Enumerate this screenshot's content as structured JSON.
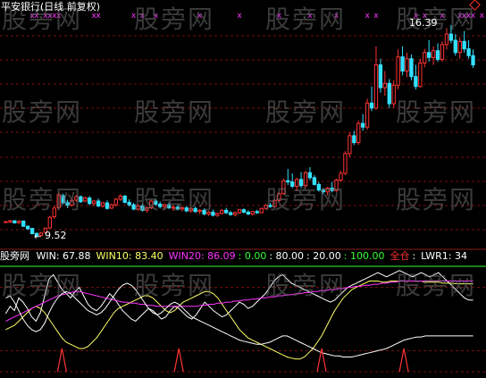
{
  "title": "平安银行(日线 前复权)",
  "watermark": "股旁网",
  "price_labels": {
    "high": "16.39",
    "low": "9.52"
  },
  "indicator_bar": {
    "name": "股旁网",
    "items": [
      {
        "text": "WIN: 67.88",
        "color": "#ffffff"
      },
      {
        "text": "WIN10: 83.40",
        "color": "#ffff66"
      },
      {
        "text": "WIN20: 86.09",
        "color": "#ff33ff"
      },
      {
        "text": ": 0.00",
        "color": "#33ff33"
      },
      {
        "text": ": 80.00",
        "color": "#ffffff"
      },
      {
        "text": ": 20.00",
        "color": "#ffffff"
      },
      {
        "text": ": 100.00",
        "color": "#33ff33"
      },
      {
        "text": "全仓",
        "color": "#ff3333"
      },
      {
        "text": ": ",
        "color": "#ffffff"
      },
      {
        "text": "LWR1: 34",
        "color": "#ffffff"
      }
    ]
  },
  "colors": {
    "background": "#000000",
    "up": "#ff3333",
    "down": "#33e0ff",
    "grid": "#7a1010",
    "win": "#ffffff",
    "win10": "#ffff66",
    "win20": "#ff33ff",
    "level100": "#33ff33",
    "signal": "#ff3333"
  },
  "chart_data": [
    {
      "type": "candlestick",
      "title": "平安银行(日线 前复权)",
      "ylim": [
        9.2,
        16.8
      ],
      "annotations": [
        {
          "text": "16.39",
          "label_of": "max"
        },
        {
          "text": "9.52",
          "label_of": "min"
        }
      ],
      "marker_symbol": "x",
      "ohlc": [
        [
          10.0,
          10.03,
          9.98,
          10.01
        ],
        [
          10.0,
          10.07,
          9.97,
          10.04
        ],
        [
          10.04,
          10.06,
          9.95,
          9.97
        ],
        [
          9.98,
          10.06,
          9.93,
          10.02
        ],
        [
          10.03,
          10.05,
          9.85,
          9.86
        ],
        [
          9.86,
          9.89,
          9.75,
          9.78
        ],
        [
          9.79,
          9.81,
          9.6,
          9.62
        ],
        [
          9.63,
          9.66,
          9.52,
          9.55
        ],
        [
          9.56,
          9.68,
          9.53,
          9.64
        ],
        [
          9.66,
          9.82,
          9.63,
          9.8
        ],
        [
          9.81,
          10.2,
          9.78,
          10.15
        ],
        [
          10.17,
          10.52,
          10.1,
          10.45
        ],
        [
          10.47,
          10.95,
          10.4,
          10.88
        ],
        [
          10.85,
          10.92,
          10.58,
          10.62
        ],
        [
          10.63,
          10.72,
          10.45,
          10.55
        ],
        [
          10.55,
          10.75,
          10.5,
          10.7
        ],
        [
          10.71,
          10.88,
          10.65,
          10.82
        ],
        [
          10.82,
          10.86,
          10.62,
          10.66
        ],
        [
          10.68,
          10.82,
          10.64,
          10.78
        ],
        [
          10.78,
          10.84,
          10.55,
          10.6
        ],
        [
          10.6,
          10.72,
          10.52,
          10.68
        ],
        [
          10.68,
          10.76,
          10.48,
          10.52
        ],
        [
          10.52,
          10.66,
          10.46,
          10.62
        ],
        [
          10.62,
          10.7,
          10.4,
          10.44
        ],
        [
          10.45,
          10.6,
          10.42,
          10.56
        ],
        [
          10.56,
          10.78,
          10.5,
          10.74
        ],
        [
          10.74,
          10.9,
          10.68,
          10.84
        ],
        [
          10.84,
          10.88,
          10.6,
          10.64
        ],
        [
          10.64,
          10.74,
          10.5,
          10.56
        ],
        [
          10.56,
          10.62,
          10.38,
          10.42
        ],
        [
          10.42,
          10.58,
          10.36,
          10.52
        ],
        [
          10.52,
          10.6,
          10.34,
          10.38
        ],
        [
          10.38,
          10.5,
          10.3,
          10.46
        ],
        [
          10.46,
          10.72,
          10.42,
          10.68
        ],
        [
          10.68,
          10.76,
          10.52,
          10.58
        ],
        [
          10.58,
          10.66,
          10.44,
          10.5
        ],
        [
          10.5,
          10.6,
          10.4,
          10.56
        ],
        [
          10.56,
          10.64,
          10.42,
          10.46
        ],
        [
          10.46,
          10.54,
          10.36,
          10.48
        ],
        [
          10.48,
          10.56,
          10.38,
          10.42
        ],
        [
          10.42,
          10.5,
          10.34,
          10.46
        ],
        [
          10.46,
          10.52,
          10.32,
          10.36
        ],
        [
          10.36,
          10.48,
          10.3,
          10.44
        ],
        [
          10.44,
          10.5,
          10.3,
          10.34
        ],
        [
          10.34,
          10.42,
          10.26,
          10.38
        ],
        [
          10.38,
          10.44,
          10.22,
          10.26
        ],
        [
          10.26,
          10.36,
          10.2,
          10.32
        ],
        [
          10.32,
          10.4,
          10.18,
          10.22
        ],
        [
          10.22,
          10.3,
          10.16,
          10.28
        ],
        [
          10.28,
          10.42,
          10.24,
          10.38
        ],
        [
          10.38,
          10.46,
          10.26,
          10.3
        ],
        [
          10.3,
          10.36,
          10.2,
          10.24
        ],
        [
          10.24,
          10.34,
          10.18,
          10.3
        ],
        [
          10.3,
          10.42,
          10.26,
          10.4
        ],
        [
          10.4,
          10.44,
          10.28,
          10.32
        ],
        [
          10.32,
          10.38,
          10.22,
          10.26
        ],
        [
          10.26,
          10.36,
          10.2,
          10.34
        ],
        [
          10.34,
          10.4,
          10.26,
          10.3
        ],
        [
          10.3,
          10.46,
          10.28,
          10.44
        ],
        [
          10.44,
          10.58,
          10.4,
          10.54
        ],
        [
          10.54,
          10.62,
          10.46,
          10.5
        ],
        [
          10.5,
          10.74,
          10.48,
          10.7
        ],
        [
          10.7,
          10.96,
          10.66,
          10.92
        ],
        [
          10.92,
          11.4,
          10.88,
          11.34
        ],
        [
          11.34,
          11.72,
          11.2,
          11.3
        ],
        [
          11.3,
          11.58,
          11.1,
          11.16
        ],
        [
          11.16,
          11.44,
          11.0,
          11.38
        ],
        [
          11.38,
          11.62,
          11.1,
          11.18
        ],
        [
          11.18,
          11.66,
          11.12,
          11.6
        ],
        [
          11.6,
          11.78,
          11.36,
          11.44
        ],
        [
          11.44,
          11.52,
          11.18,
          11.22
        ],
        [
          11.22,
          11.3,
          10.98,
          11.04
        ],
        [
          11.04,
          11.1,
          10.9,
          10.98
        ],
        [
          10.98,
          11.14,
          10.86,
          11.1
        ],
        [
          11.1,
          11.3,
          10.96,
          11.02
        ],
        [
          11.02,
          11.4,
          10.98,
          11.36
        ],
        [
          11.36,
          11.66,
          11.3,
          11.58
        ],
        [
          11.58,
          12.3,
          11.52,
          12.22
        ],
        [
          12.22,
          12.9,
          12.1,
          12.8
        ],
        [
          12.8,
          12.96,
          12.5,
          12.58
        ],
        [
          12.58,
          13.3,
          12.5,
          13.2
        ],
        [
          13.2,
          13.5,
          12.96,
          13.08
        ],
        [
          13.08,
          14.0,
          13.0,
          13.86
        ],
        [
          13.86,
          14.4,
          13.6,
          13.7
        ],
        [
          13.7,
          15.7,
          13.64,
          15.1
        ],
        [
          15.1,
          15.3,
          14.2,
          14.36
        ],
        [
          14.36,
          14.9,
          14.1,
          14.5
        ],
        [
          14.5,
          14.64,
          13.7,
          13.84
        ],
        [
          13.84,
          14.6,
          13.7,
          14.44
        ],
        [
          14.44,
          15.6,
          14.3,
          15.36
        ],
        [
          15.36,
          15.7,
          14.76,
          14.9
        ],
        [
          14.9,
          15.5,
          14.7,
          15.3
        ],
        [
          15.3,
          15.44,
          14.6,
          14.72
        ],
        [
          14.72,
          15.1,
          14.3,
          14.4
        ],
        [
          14.4,
          15.3,
          14.36,
          15.16
        ],
        [
          15.16,
          15.62,
          15.02,
          15.5
        ],
        [
          15.5,
          15.9,
          15.2,
          15.34
        ],
        [
          15.34,
          15.7,
          15.1,
          15.56
        ],
        [
          15.56,
          15.8,
          15.2,
          15.28
        ],
        [
          15.28,
          15.86,
          15.2,
          15.76
        ],
        [
          15.76,
          16.3,
          15.6,
          16.1
        ],
        [
          16.1,
          16.39,
          15.8,
          15.9
        ],
        [
          15.9,
          16.1,
          15.4,
          15.5
        ],
        [
          15.5,
          16.0,
          15.3,
          15.86
        ],
        [
          15.86,
          16.2,
          15.5,
          15.62
        ],
        [
          15.62,
          15.9,
          15.3,
          15.4
        ],
        [
          15.4,
          15.6,
          15.0,
          15.1
        ]
      ],
      "x_marker_indices": [
        6,
        7,
        9,
        10,
        11,
        12,
        20,
        21,
        29,
        31,
        34,
        44,
        53,
        62,
        69,
        75,
        82,
        84,
        93,
        95,
        99,
        103,
        104,
        105,
        106,
        108
      ]
    },
    {
      "type": "line",
      "indicator": "WIN",
      "ylim": [
        0,
        100
      ],
      "reference_lines": [
        0,
        20,
        80,
        100
      ],
      "signal_name": "全仓",
      "signal_indices": [
        13,
        40,
        73,
        92
      ],
      "series": [
        {
          "name": "WIN",
          "values": [
            55,
            62,
            58,
            70,
            66,
            60,
            52,
            48,
            56,
            72,
            88,
            92,
            85,
            78,
            74,
            70,
            76,
            80,
            72,
            64,
            60,
            58,
            62,
            68,
            74,
            70,
            64,
            58,
            54,
            50,
            48,
            52,
            56,
            60,
            58,
            54,
            50,
            52,
            58,
            62,
            60,
            56,
            52,
            50,
            54,
            60,
            66,
            62,
            58,
            55,
            52,
            54,
            58,
            62,
            66,
            64,
            60,
            62,
            66,
            70,
            74,
            80,
            86,
            90,
            92,
            88,
            84,
            82,
            80,
            78,
            76,
            74,
            72,
            70,
            68,
            66,
            68,
            72,
            76,
            80,
            82,
            84,
            86,
            88,
            90,
            92,
            94,
            92,
            90,
            92,
            94,
            96,
            94,
            92,
            90,
            92,
            94,
            92,
            90,
            92,
            94,
            90,
            86,
            82,
            78,
            74,
            70,
            68,
            67.88
          ]
        },
        {
          "name": "WIN10",
          "values": [
            40,
            42,
            44,
            48,
            52,
            56,
            60,
            62,
            60,
            56,
            50,
            44,
            38,
            32,
            28,
            26,
            24,
            22,
            22,
            24,
            28,
            32,
            38,
            44,
            50,
            56,
            60,
            62,
            64,
            66,
            68,
            70,
            72,
            72,
            70,
            66,
            62,
            58,
            56,
            58,
            62,
            66,
            68,
            70,
            72,
            74,
            76,
            76,
            74,
            70,
            64,
            58,
            52,
            46,
            40,
            36,
            32,
            30,
            28,
            26,
            24,
            22,
            20,
            18,
            16,
            14,
            13,
            12,
            12,
            14,
            18,
            22,
            28,
            34,
            42,
            50,
            58,
            64,
            70,
            74,
            78,
            80,
            82,
            84,
            86,
            86,
            86,
            85,
            85,
            86,
            86,
            86,
            86,
            86,
            86,
            86,
            86,
            85,
            85,
            85,
            85,
            84,
            84,
            84,
            83.5,
            83.4,
            83.4,
            83.4,
            83.4
          ]
        },
        {
          "name": "WIN20",
          "values": [
            48,
            50,
            52,
            54,
            56,
            58,
            60,
            62,
            64,
            66,
            68,
            70,
            72,
            73,
            74,
            75,
            76,
            76,
            75,
            74,
            73,
            72,
            71,
            70,
            69,
            68,
            67,
            66,
            66,
            65,
            65,
            64,
            64,
            63,
            63,
            62,
            62,
            62,
            62,
            62,
            62,
            62,
            62,
            62,
            62,
            63,
            63,
            64,
            64,
            65,
            65,
            66,
            66,
            67,
            67,
            68,
            68,
            69,
            69,
            70,
            70,
            71,
            71,
            72,
            72,
            73,
            73,
            74,
            74,
            75,
            75,
            76,
            76,
            77,
            77,
            78,
            78,
            79,
            79,
            80,
            80,
            81,
            81,
            82,
            82,
            83,
            83,
            84,
            84,
            85,
            85,
            86,
            86,
            86,
            86,
            86,
            86,
            86,
            86,
            86,
            86,
            86,
            86,
            86,
            86,
            86,
            86,
            86.09,
            86.09
          ]
        },
        {
          "name": "LWR1",
          "values": [
            70,
            72,
            66,
            58,
            50,
            44,
            40,
            38,
            40,
            46,
            56,
            64,
            70,
            74,
            76,
            74,
            70,
            66,
            62,
            58,
            56,
            54,
            56,
            60,
            66,
            72,
            78,
            82,
            84,
            82,
            78,
            72,
            66,
            60,
            56,
            54,
            56,
            60,
            64,
            66,
            64,
            60,
            56,
            52,
            50,
            48,
            46,
            44,
            42,
            40,
            38,
            36,
            34,
            32,
            30,
            29,
            28,
            27,
            26,
            26,
            27,
            28,
            30,
            32,
            34,
            34,
            32,
            30,
            28,
            26,
            24,
            22,
            20,
            18,
            17,
            16,
            15,
            15,
            14,
            14,
            14,
            15,
            16,
            17,
            18,
            19,
            20,
            21,
            22,
            24,
            26,
            28,
            30,
            31,
            32,
            33,
            33,
            34,
            34,
            34,
            34,
            34,
            34,
            34,
            34,
            34,
            34,
            34,
            34
          ]
        }
      ]
    }
  ]
}
